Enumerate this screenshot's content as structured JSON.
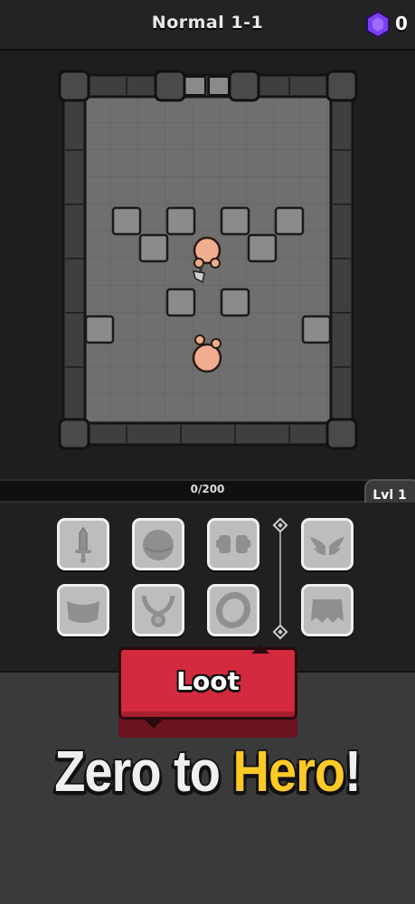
{
  "header": {
    "level_title": "Normal 1-1",
    "gem_icon": "purple-gem-icon",
    "gem_count": "0"
  },
  "arena": {
    "player_icon": "hero-with-axe-icon",
    "enemy_icon": "bald-brawler-icon"
  },
  "progress": {
    "text": "0/200",
    "value": 0,
    "max": 200,
    "level_badge": "Lvl 1"
  },
  "equipment": {
    "slots": [
      {
        "name": "sword-slot",
        "icon": "sword-icon"
      },
      {
        "name": "helmet-slot",
        "icon": "helmet-icon"
      },
      {
        "name": "gloves-slot",
        "icon": "gloves-icon"
      },
      {
        "name": "wings-slot",
        "icon": "wings-icon"
      },
      {
        "name": "armor-slot",
        "icon": "armor-icon"
      },
      {
        "name": "amulet-slot",
        "icon": "amulet-icon"
      },
      {
        "name": "ring-slot",
        "icon": "ring-icon"
      },
      {
        "name": "cape-slot",
        "icon": "cape-icon"
      }
    ]
  },
  "actions": {
    "loot_label": "Loot"
  },
  "tagline": {
    "part1": "Zero to ",
    "part2": "Hero",
    "part3": "!"
  },
  "colors": {
    "loot_red": "#d32a3e",
    "hero_yellow": "#ffc928",
    "gem_purple": "#7b3ff2"
  }
}
